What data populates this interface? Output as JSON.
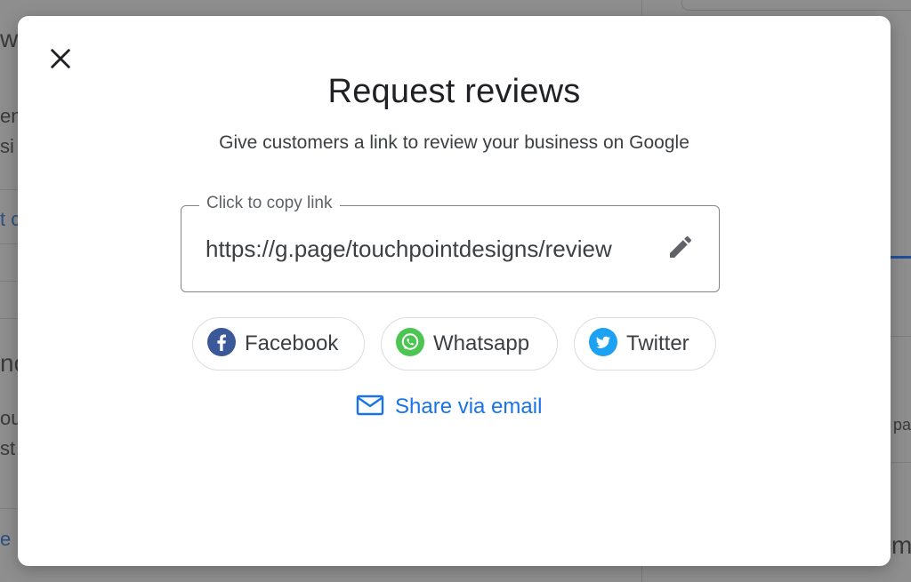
{
  "background": {
    "fragments": [
      "w",
      "en",
      "si",
      "t c",
      "no",
      "ou",
      "st",
      "e",
      "pa",
      "ma"
    ]
  },
  "dialog": {
    "title": "Request reviews",
    "subtitle": "Give customers a link to review your business on Google",
    "link_field": {
      "label": "Click to copy link",
      "value": "https://g.page/touchpointdesigns/review"
    },
    "share_buttons": [
      {
        "label": "Facebook",
        "icon": "facebook-icon",
        "color": "#3b5998"
      },
      {
        "label": "Whatsapp",
        "icon": "whatsapp-icon",
        "color": "#4cc552"
      },
      {
        "label": "Twitter",
        "icon": "twitter-icon",
        "color": "#1da1f2"
      }
    ],
    "email_link": {
      "label": "Share via email",
      "icon": "mail-icon",
      "color": "#1a73e8"
    }
  },
  "colors": {
    "accent": "#1a73e8",
    "overlay": "#8e8e8e"
  }
}
